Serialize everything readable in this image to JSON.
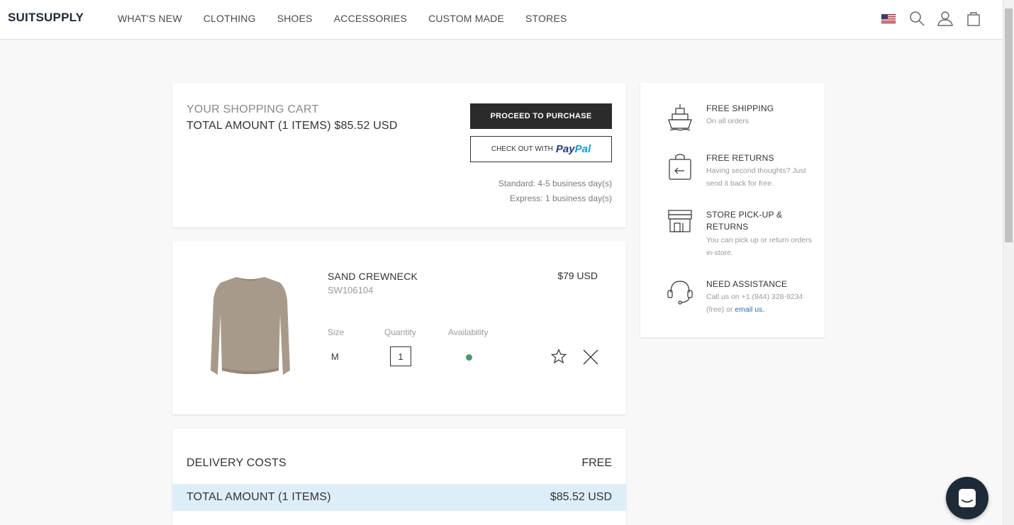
{
  "header": {
    "logo": "SUITSUPPLY",
    "nav": [
      "WHAT'S NEW",
      "CLOTHING",
      "SHOES",
      "ACCESSORIES",
      "CUSTOM MADE",
      "STORES"
    ],
    "icons": [
      "us-flag-icon",
      "search-icon",
      "account-icon",
      "bag-icon"
    ]
  },
  "summary": {
    "title": "YOUR SHOPPING CART",
    "total": "TOTAL AMOUNT (1 ITEMS) $85.52 USD",
    "proceed_label": "PROCEED TO PURCHASE",
    "paypal_prefix": "CHECK OUT WITH",
    "paypal_pay": "Pay",
    "paypal_pal": "Pal",
    "shipping_standard": "Standard: 4-5 business day(s)",
    "shipping_express": "Express: 1 business day(s)"
  },
  "item": {
    "name": "SAND CREWNECK",
    "sku": "SW106104",
    "price": "$79 USD",
    "size_label": "Size",
    "quantity_label": "Quantity",
    "availability_label": "Availability",
    "size": "M",
    "quantity": "1",
    "availability_color": "#4c9a6f"
  },
  "totals": {
    "delivery_label": "DELIVERY COSTS",
    "delivery_value": "FREE",
    "total_label": "TOTAL AMOUNT (1 ITEMS)",
    "total_value": "$85.52 USD"
  },
  "usps": [
    {
      "title": "FREE SHIPPING",
      "desc": "On all orders",
      "icon": "ship-icon"
    },
    {
      "title": "FREE RETURNS",
      "desc": "Having second thoughts? Just send it back for free.",
      "icon": "return-bag-icon"
    },
    {
      "title": "STORE PICK-UP & RETURNS",
      "desc": "You can pick up or return orders in-store.",
      "icon": "store-icon"
    },
    {
      "title": "NEED ASSISTANCE",
      "desc": "Call us on +1 (844) 328-9234 (free) or",
      "link": "email us.",
      "icon": "headset-icon"
    }
  ],
  "colors": {
    "brand": "#1f2a38",
    "button_dark": "#2b2b2b",
    "total_highlight": "#ddeef9",
    "link": "#2a6ebb"
  }
}
